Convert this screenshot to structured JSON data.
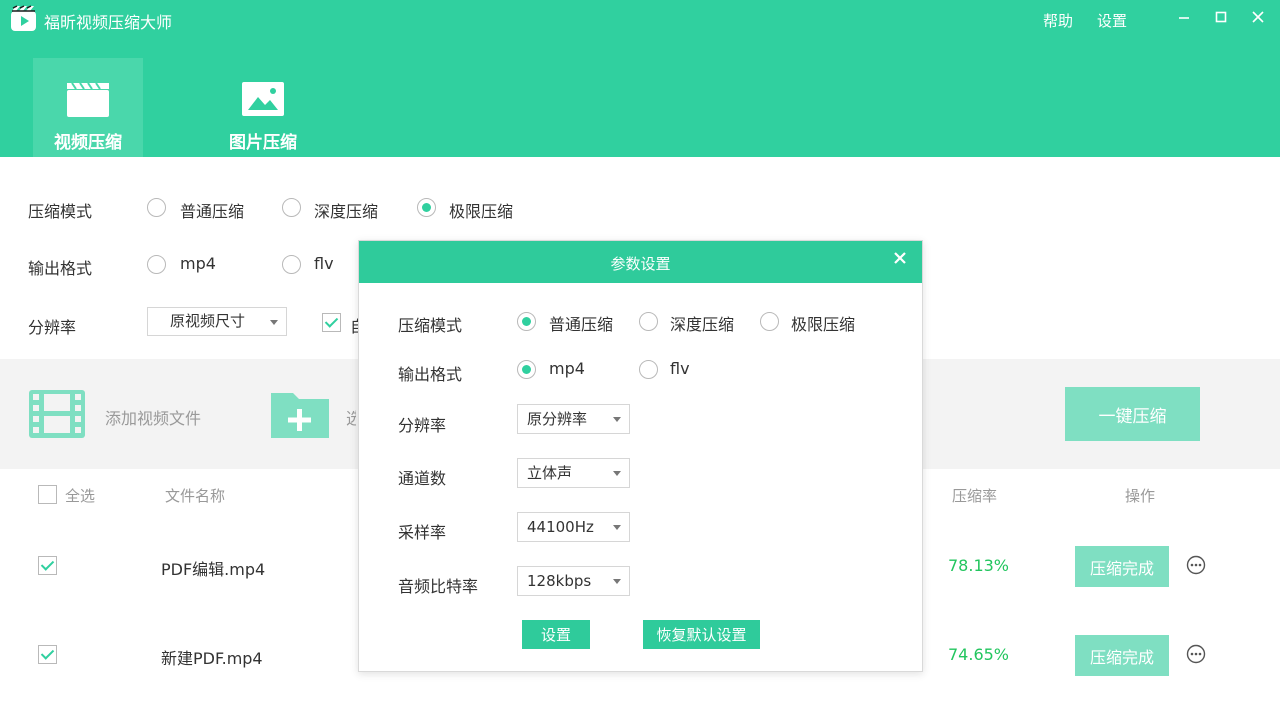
{
  "app": {
    "title": "福昕视频压缩大师",
    "help": "帮助",
    "settings": "设置"
  },
  "tabs": [
    {
      "label": "视频压缩",
      "active": true
    },
    {
      "label": "图片压缩",
      "active": false
    }
  ],
  "settings": {
    "mode_label": "压缩模式",
    "mode_options": [
      "普通压缩",
      "深度压缩",
      "极限压缩"
    ],
    "mode_selected": "极限压缩",
    "format_label": "输出格式",
    "format_options": [
      "mp4",
      "flv"
    ],
    "resolution_label": "分辨率",
    "resolution_value": "原视频尺寸",
    "resolution_checkbox_partial": "自"
  },
  "toolbar": {
    "add_video": "添加视频文件",
    "add_folder_partial": "选",
    "compress_all": "一键压缩"
  },
  "table": {
    "select_all": "全选",
    "col_name": "文件名称",
    "col_ratio": "压缩率",
    "col_action": "操作",
    "rows": [
      {
        "name": "PDF编辑.mp4",
        "ratio": "78.13%",
        "status": "压缩完成",
        "checked": true
      },
      {
        "name": "新建PDF.mp4",
        "ratio": "74.65%",
        "status": "压缩完成",
        "checked": true
      }
    ]
  },
  "modal": {
    "title": "参数设置",
    "mode_label": "压缩模式",
    "mode_options": [
      "普通压缩",
      "深度压缩",
      "极限压缩"
    ],
    "mode_selected": "普通压缩",
    "format_label": "输出格式",
    "format_options": [
      "mp4",
      "flv"
    ],
    "format_selected": "mp4",
    "resolution_label": "分辨率",
    "resolution_value": "原分辨率",
    "channels_label": "通道数",
    "channels_value": "立体声",
    "sample_rate_label": "采样率",
    "sample_rate_value": "44100Hz",
    "bitrate_label": "音频比特率",
    "bitrate_value": "128kbps",
    "apply_button": "设置",
    "reset_button": "恢复默认设置"
  },
  "colors": {
    "brand": "#30d09f",
    "accent_light": "#7fdfc2",
    "ratio_green": "#22c55e"
  }
}
